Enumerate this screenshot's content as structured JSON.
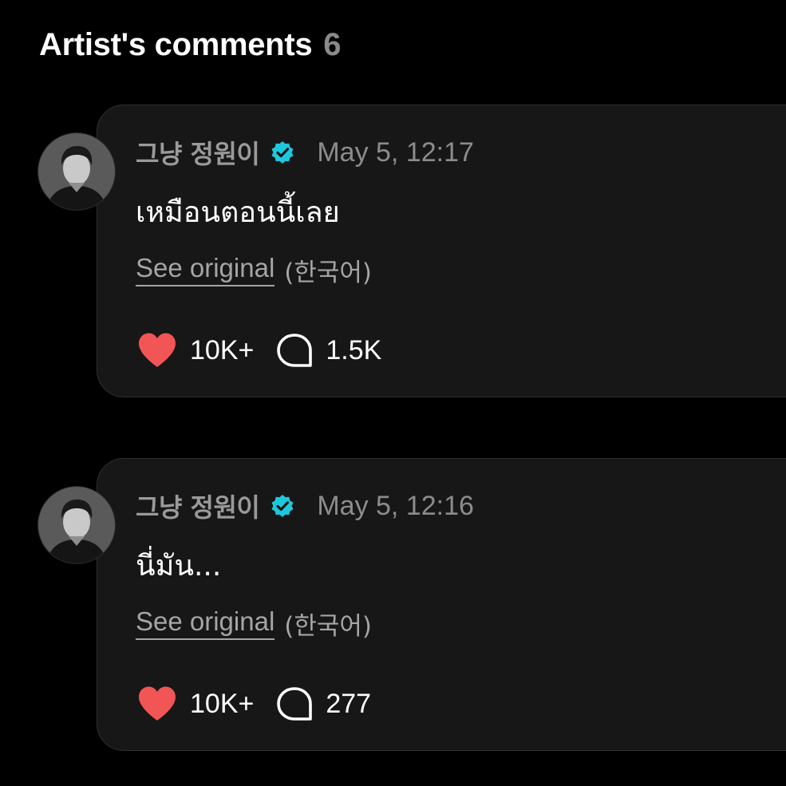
{
  "section": {
    "title": "Artist's comments",
    "count": "6"
  },
  "theme": {
    "background": "#000000",
    "card": "#171717",
    "verified": "#1ec8dc",
    "like": "#f25555"
  },
  "comments": [
    {
      "author": "그냥 정원이",
      "verified_icon": "verified-badge-icon",
      "timestamp": "May 5, 12:17",
      "text": "เหมือนตอนนี้เลย",
      "see_original": "See original",
      "language": "(한국어)",
      "likes": "10K+",
      "replies": "1.5K"
    },
    {
      "author": "그냥 정원이",
      "verified_icon": "verified-badge-icon",
      "timestamp": "May 5, 12:16",
      "text": "นี่มัน...",
      "see_original": "See original",
      "language": "(한국어)",
      "likes": "10K+",
      "replies": "277"
    }
  ]
}
